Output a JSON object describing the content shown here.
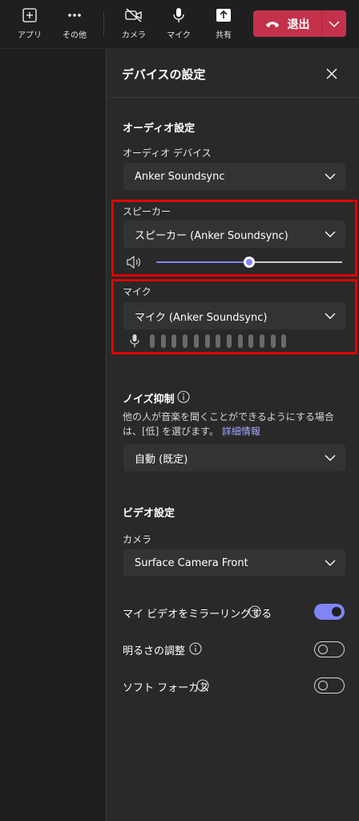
{
  "toolbar": {
    "apps_label": "アプリ",
    "more_label": "その他",
    "camera_label": "カメラ",
    "mic_label": "マイク",
    "share_label": "共有",
    "leave_label": "退出"
  },
  "panel": {
    "title": "デバイスの設定",
    "audio": {
      "section_title": "オーディオ設定",
      "device_label": "オーディオ デバイス",
      "device_value": "Anker Soundsync",
      "speaker_label": "スピーカー",
      "speaker_value": "スピーカー (Anker Soundsync)",
      "speaker_volume_fraction": 0.5,
      "mic_label": "マイク",
      "mic_value": "マイク (Anker Soundsync)",
      "mic_level_fraction": 0
    },
    "noise": {
      "title": "ノイズ抑制",
      "description": "他の人が音楽を聞くことができるようにする場合は、[低] を選びます。",
      "link_text": "詳細情報",
      "value": "自動 (既定)"
    },
    "video": {
      "section_title": "ビデオ設定",
      "camera_label": "カメラ",
      "camera_value": "Surface Camera Front",
      "mirror_label": "マイ ビデオをミラーリングする",
      "mirror_on": true,
      "brightness_label": "明るさの調整",
      "brightness_on": false,
      "softfocus_label": "ソフト フォーカス",
      "softfocus_on": false
    }
  },
  "colors": {
    "accent": "#7f85f5",
    "leave_button": "#c4314b",
    "highlight_box": "#e00000"
  }
}
